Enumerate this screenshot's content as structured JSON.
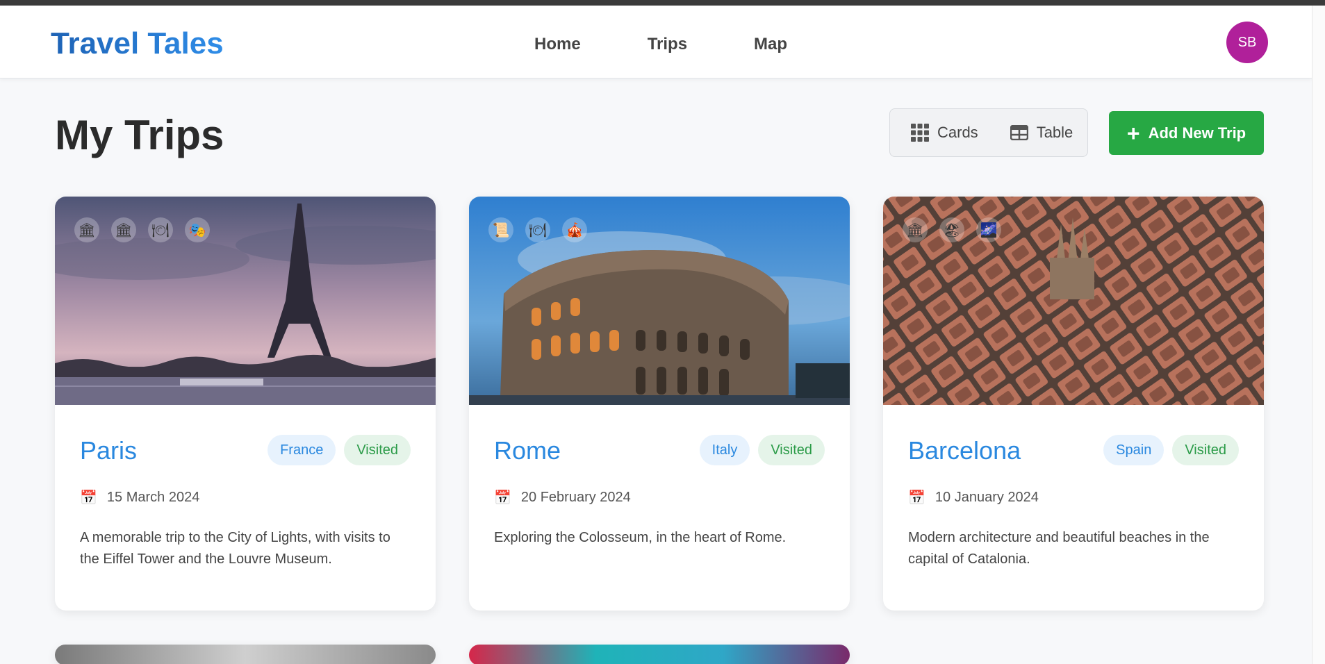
{
  "app": {
    "title": "Travel Tales"
  },
  "nav": {
    "items": [
      "Home",
      "Trips",
      "Map"
    ]
  },
  "user": {
    "initials": "SB",
    "avatar_color": "#b0209a"
  },
  "page": {
    "title": "My Trips"
  },
  "view_toggle": {
    "cards_label": "Cards",
    "table_label": "Table"
  },
  "actions": {
    "add_trip_label": "Add New Trip",
    "accent": "#27a844"
  },
  "trips": [
    {
      "city": "Paris",
      "country": "France",
      "status": "Visited",
      "date": "15 March 2024",
      "description": "A memorable trip to the City of Lights, with visits to the Eiffel Tower and the Louvre Museum.",
      "icons": [
        "museum-icon",
        "museum-icon",
        "dining-icon",
        "theater-icon"
      ]
    },
    {
      "city": "Rome",
      "country": "Italy",
      "status": "Visited",
      "date": "20 February 2024",
      "description": "Exploring the Colosseum, in the heart of Rome.",
      "icons": [
        "scroll-icon",
        "dining-icon",
        "circus-tent-icon"
      ]
    },
    {
      "city": "Barcelona",
      "country": "Spain",
      "status": "Visited",
      "date": "10 January 2024",
      "description": "Modern architecture and beautiful beaches in the capital of Catalonia.",
      "icons": [
        "museum-icon",
        "beach-umbrella-icon",
        "night-sky-icon"
      ]
    }
  ]
}
